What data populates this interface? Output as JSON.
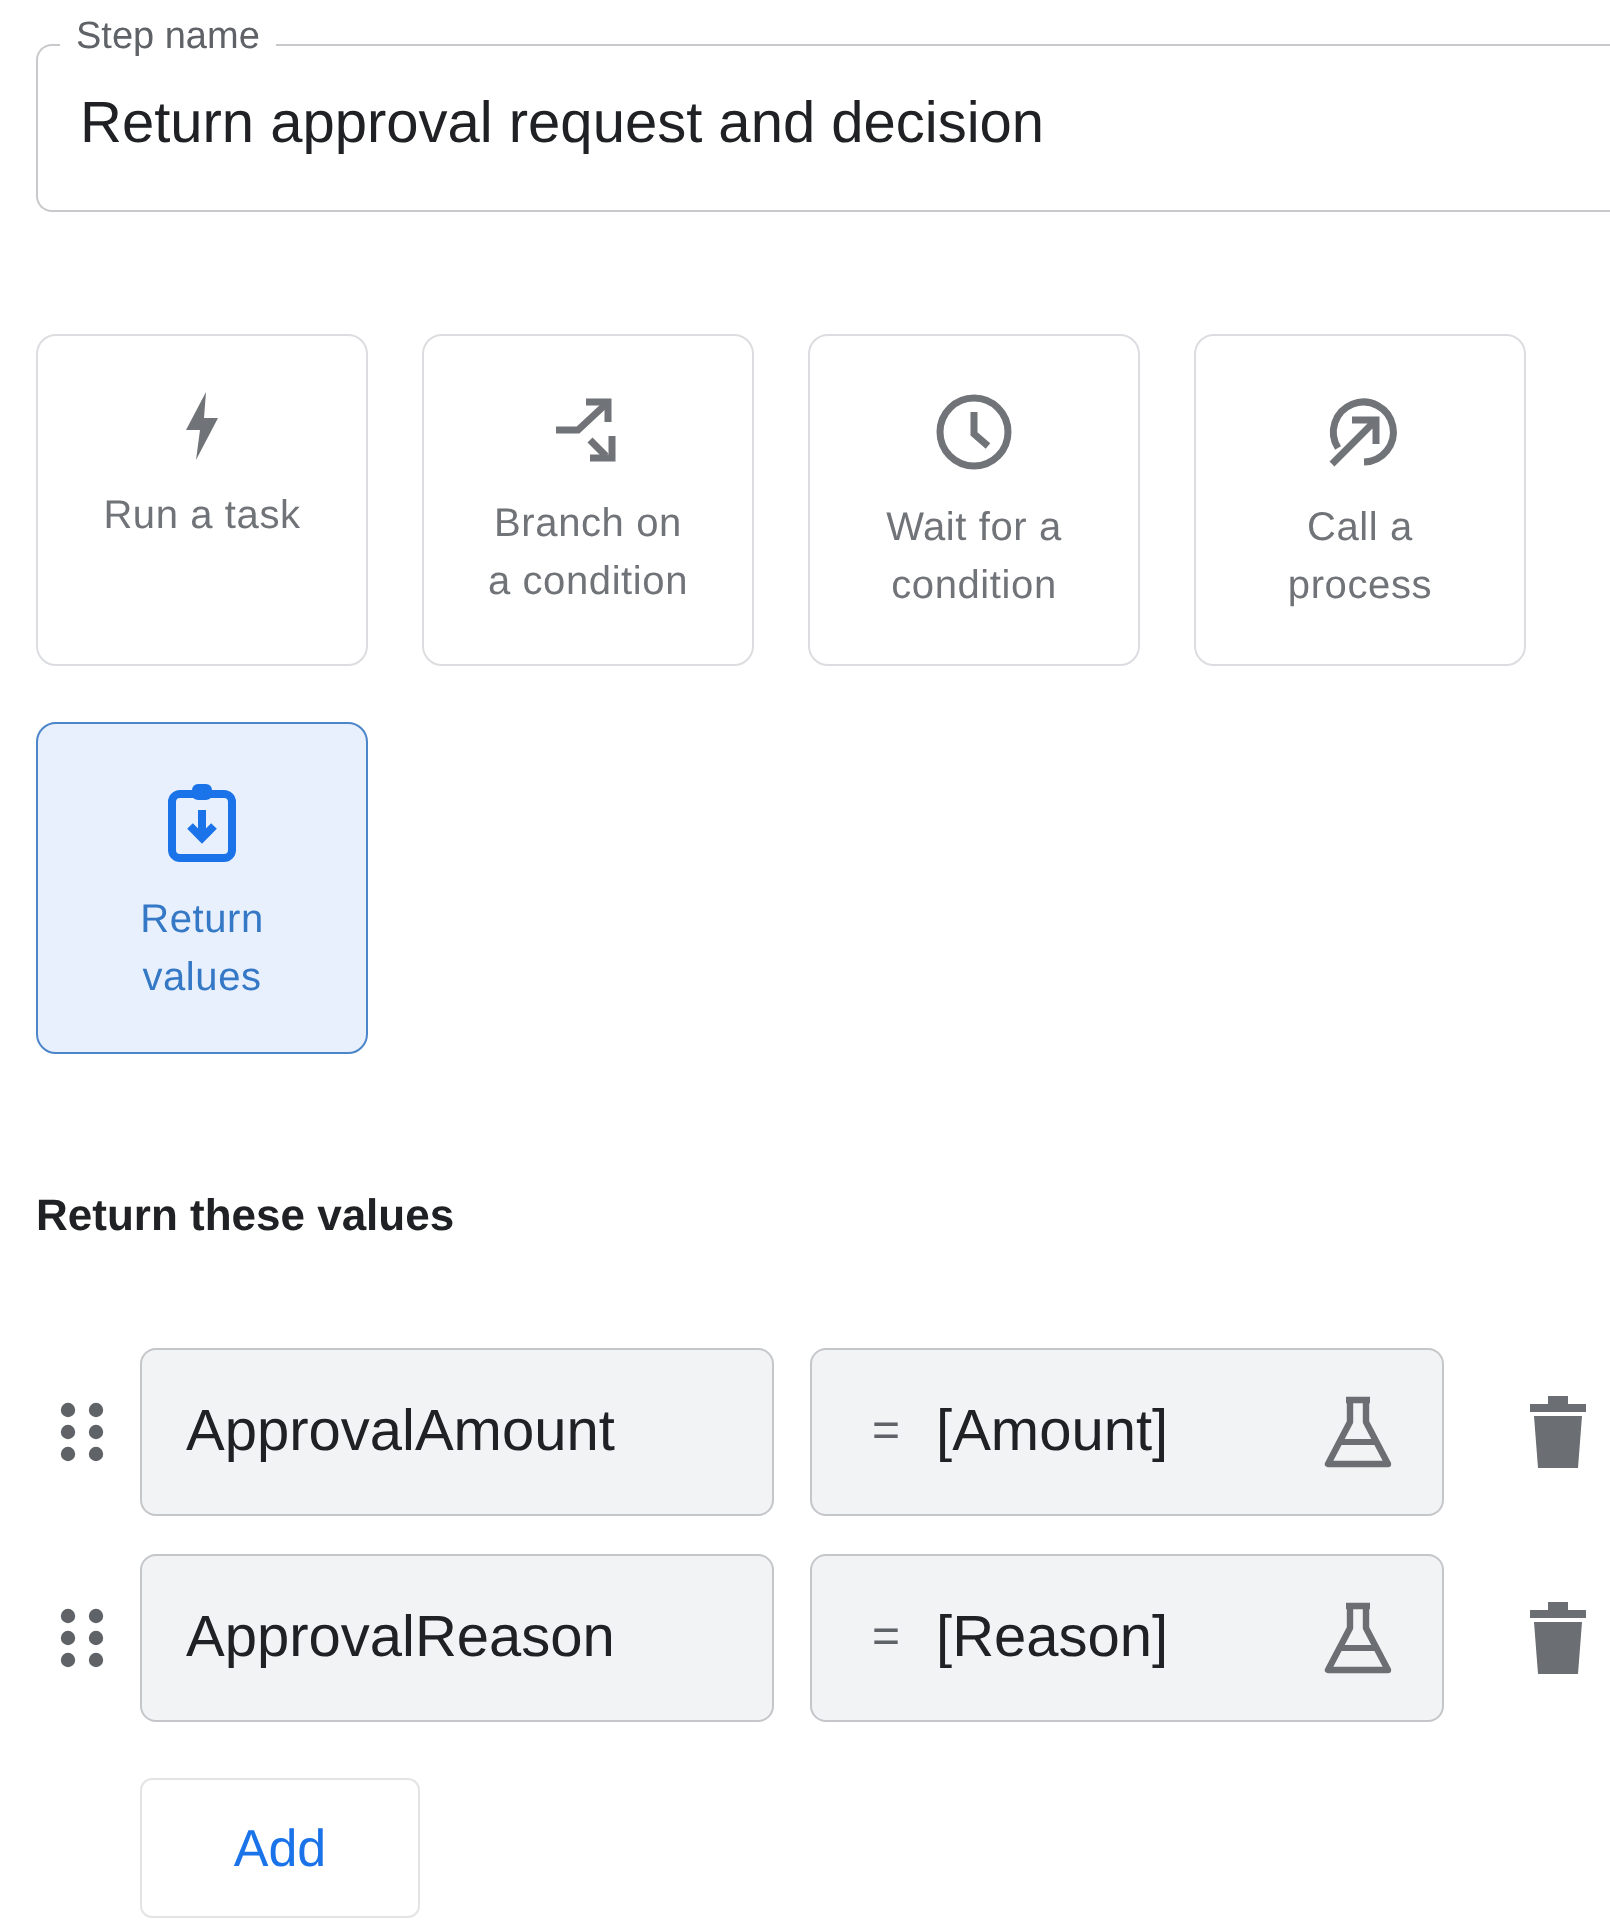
{
  "step_name": {
    "label": "Step name",
    "value": "Return approval request and decision"
  },
  "step_types": [
    {
      "kind": "bolt",
      "label": "Run a task",
      "selected": false
    },
    {
      "kind": "branch",
      "label": "Branch on\na condition",
      "selected": false
    },
    {
      "kind": "clock",
      "label": "Wait for a\ncondition",
      "selected": false
    },
    {
      "kind": "call",
      "label": "Call a\nprocess",
      "selected": false
    },
    {
      "kind": "return",
      "label": "Return\nvalues",
      "selected": true
    }
  ],
  "return_section": {
    "title": "Return these values",
    "rows": [
      {
        "name": "ApprovalAmount",
        "operator": "=",
        "value": "[Amount]"
      },
      {
        "name": "ApprovalReason",
        "operator": "=",
        "value": "[Reason]"
      }
    ],
    "add_button": "Add"
  }
}
